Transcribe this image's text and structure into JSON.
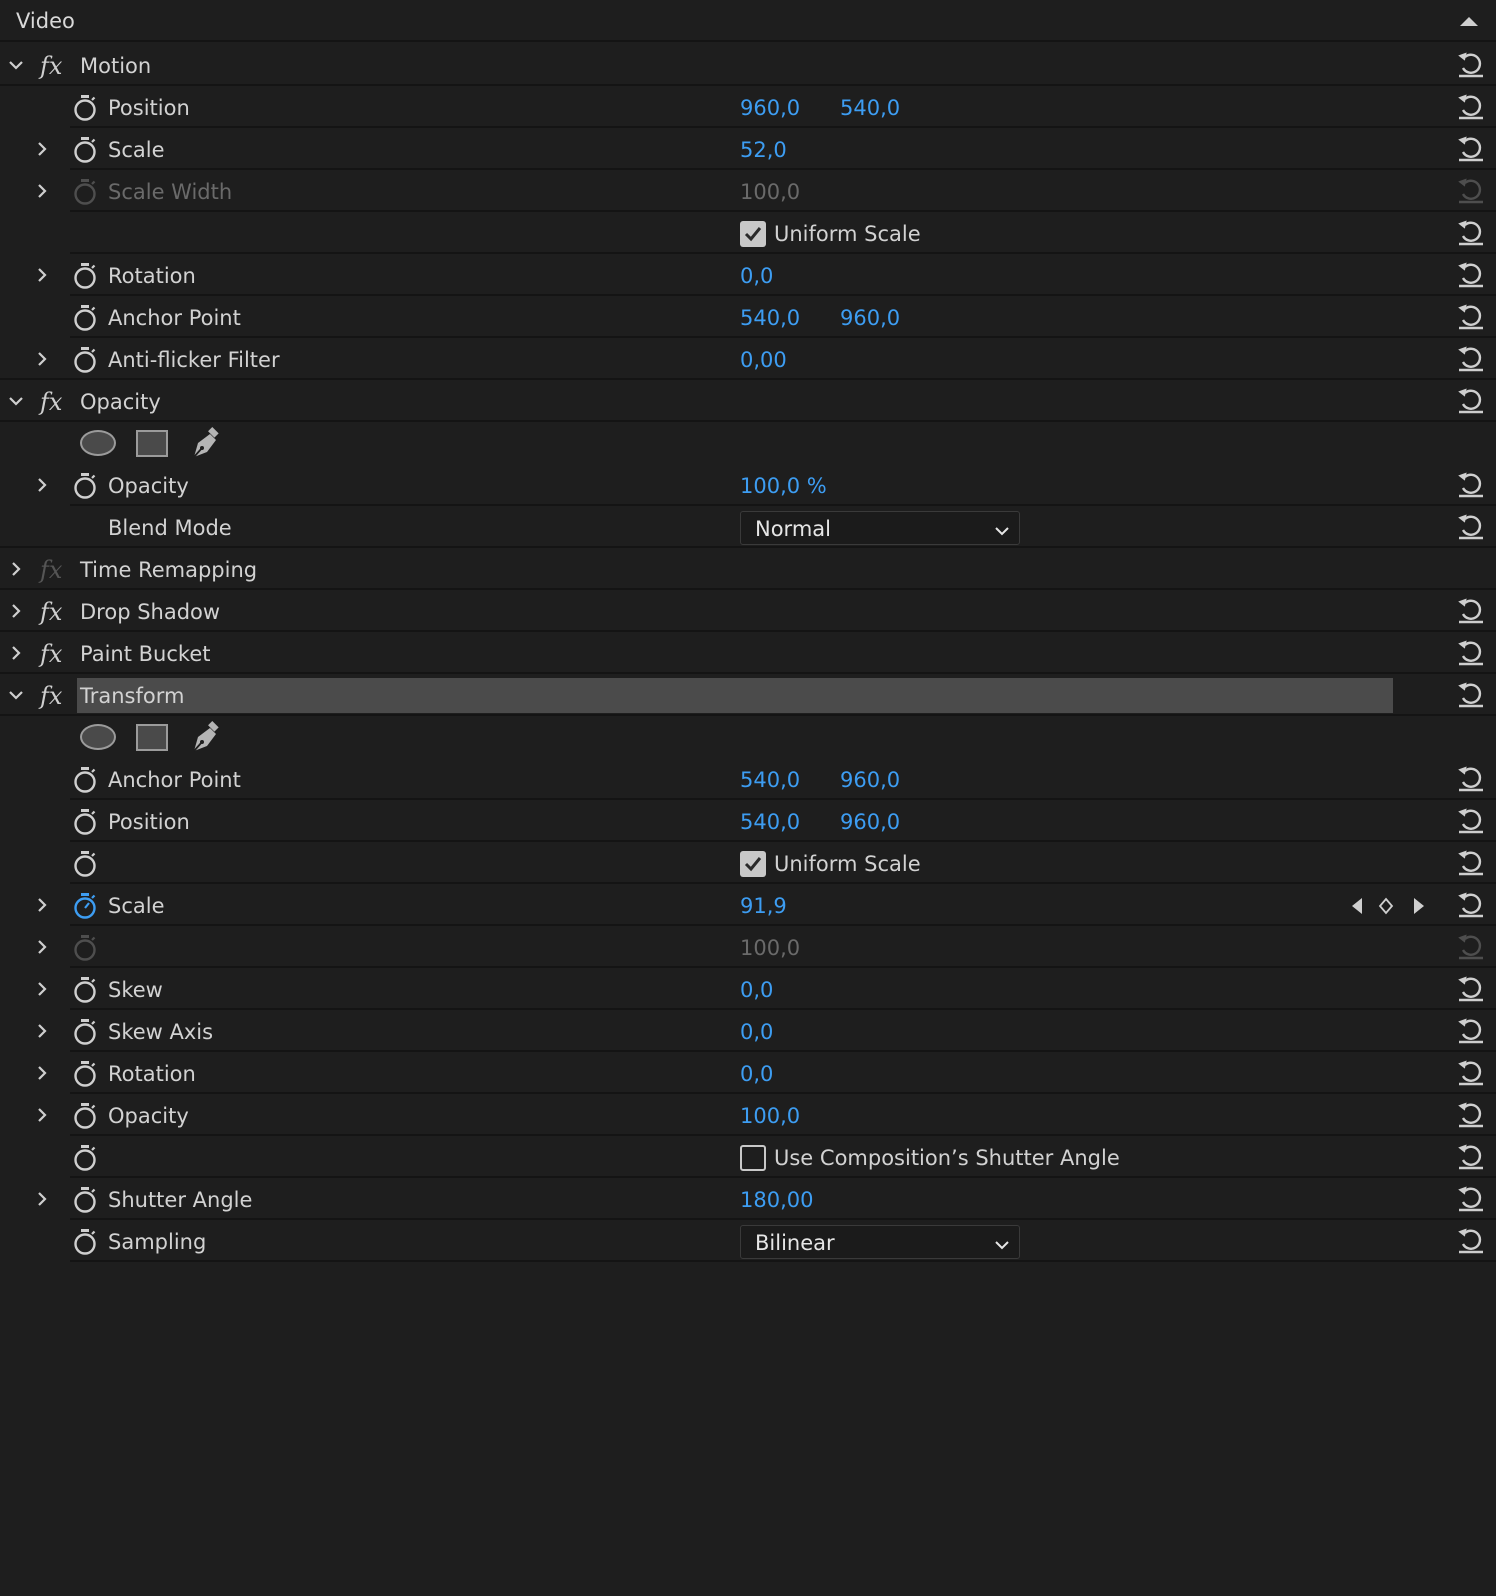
{
  "header": {
    "title": "Video"
  },
  "motion": {
    "title": "Motion",
    "position": {
      "label": "Position",
      "x": "960,0",
      "y": "540,0"
    },
    "scale": {
      "label": "Scale",
      "value": "52,0"
    },
    "scale_width": {
      "label": "Scale Width",
      "value": "100,0"
    },
    "uniform_scale": {
      "label": "Uniform Scale",
      "checked": true
    },
    "rotation": {
      "label": "Rotation",
      "value": "0,0"
    },
    "anchor_point": {
      "label": "Anchor Point",
      "x": "540,0",
      "y": "960,0"
    },
    "anti_flicker": {
      "label": "Anti-flicker Filter",
      "value": "0,00"
    }
  },
  "opacity": {
    "title": "Opacity",
    "opacity": {
      "label": "Opacity",
      "value": "100,0 %"
    },
    "blend_mode": {
      "label": "Blend Mode",
      "value": "Normal"
    }
  },
  "effects": {
    "time_remapping": "Time Remapping",
    "drop_shadow": "Drop Shadow",
    "paint_bucket": "Paint Bucket"
  },
  "transform": {
    "title": "Transform",
    "anchor_point": {
      "label": "Anchor Point",
      "x": "540,0",
      "y": "960,0"
    },
    "position": {
      "label": "Position",
      "x": "540,0",
      "y": "960,0"
    },
    "uniform_scale": {
      "label": "Uniform Scale",
      "checked": true
    },
    "scale": {
      "label": "Scale",
      "value": "91,9"
    },
    "scale_width": {
      "value": "100,0"
    },
    "skew": {
      "label": "Skew",
      "value": "0,0"
    },
    "skew_axis": {
      "label": "Skew Axis",
      "value": "0,0"
    },
    "rotation": {
      "label": "Rotation",
      "value": "0,0"
    },
    "opacity": {
      "label": "Opacity",
      "value": "100,0"
    },
    "use_comp_shutter": {
      "label": "Use Composition’s Shutter Angle",
      "checked": false
    },
    "shutter_angle": {
      "label": "Shutter Angle",
      "value": "180,00"
    },
    "sampling": {
      "label": "Sampling",
      "value": "Bilinear"
    }
  },
  "icons": {
    "stopwatch": "stopwatch-icon",
    "reset": "reset-icon",
    "fx": "fx-icon",
    "ellipse_mask": "ellipse-mask-icon",
    "rectangle_mask": "rectangle-mask-icon",
    "pen_mask": "pen-mask-icon"
  },
  "colors": {
    "background": "#1e1e1e",
    "value_blue": "#3d9df2",
    "label": "#d2d2d2",
    "disabled": "#6a6a6a",
    "highlight": "#4b4b4b"
  }
}
